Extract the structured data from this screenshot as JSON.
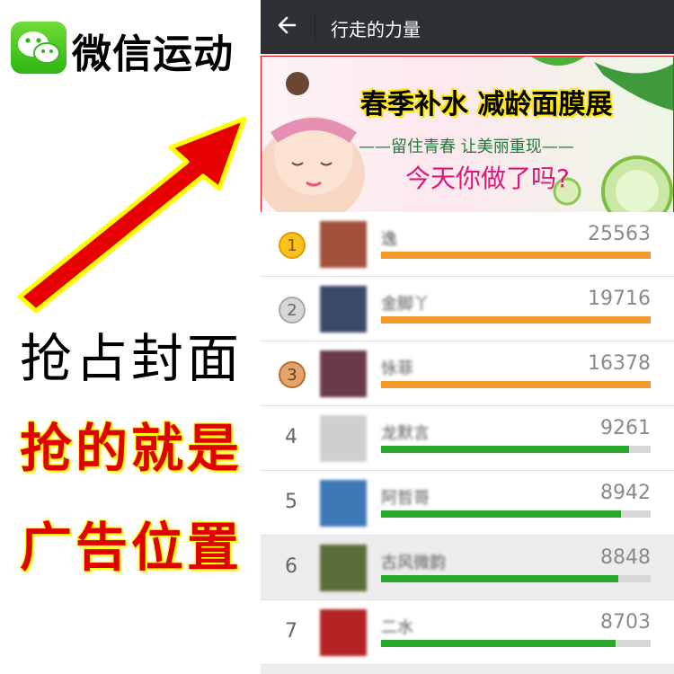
{
  "promo": {
    "app_name": "微信运动",
    "headline": "抢占封面",
    "slogan_line1": "抢的就是",
    "slogan_line2": "广告位置",
    "arrow_color": "#e60000",
    "arrow_outline": "#ffff00",
    "icons": {
      "logo": "wechat-logo-icon",
      "arrow": "pointer-arrow-icon"
    }
  },
  "screen": {
    "title": "行走的力量",
    "back_icon": "back-arrow-icon",
    "topbar_color": "#2e3134",
    "banner": {
      "headline": "春季补水 减龄面膜展",
      "subline": "——留住青春 让美丽重现——",
      "question": "今天你做了吗?",
      "border_color": "#e3151a"
    },
    "colors": {
      "top3_bar": "#f29a2e",
      "other_bar": "#2aaa2a"
    },
    "ranking": [
      {
        "rank": "1",
        "name": "逸",
        "steps": "25563",
        "progress": 1.0,
        "medal": "gold",
        "avatar_color": "#a2503a"
      },
      {
        "rank": "2",
        "name": "金脚丫",
        "steps": "19716",
        "progress": 1.0,
        "medal": "silver",
        "avatar_color": "#3c4a6a"
      },
      {
        "rank": "3",
        "name": "怺菲",
        "steps": "16378",
        "progress": 1.0,
        "medal": "bronze",
        "avatar_color": "#6a3a4a"
      },
      {
        "rank": "4",
        "name": "龙默言",
        "steps": "9261",
        "progress": 0.92,
        "medal": "",
        "avatar_color": "#cfcfcf"
      },
      {
        "rank": "5",
        "name": "阿哲哥",
        "steps": "8942",
        "progress": 0.89,
        "medal": "",
        "avatar_color": "#3f78b6"
      },
      {
        "rank": "6",
        "name": "古风微韵",
        "steps": "8848",
        "progress": 0.88,
        "medal": "",
        "avatar_color": "#5b6e3a",
        "highlighted": true
      },
      {
        "rank": "7",
        "name": "二水",
        "steps": "8703",
        "progress": 0.87,
        "medal": "",
        "avatar_color": "#b42424"
      }
    ]
  }
}
